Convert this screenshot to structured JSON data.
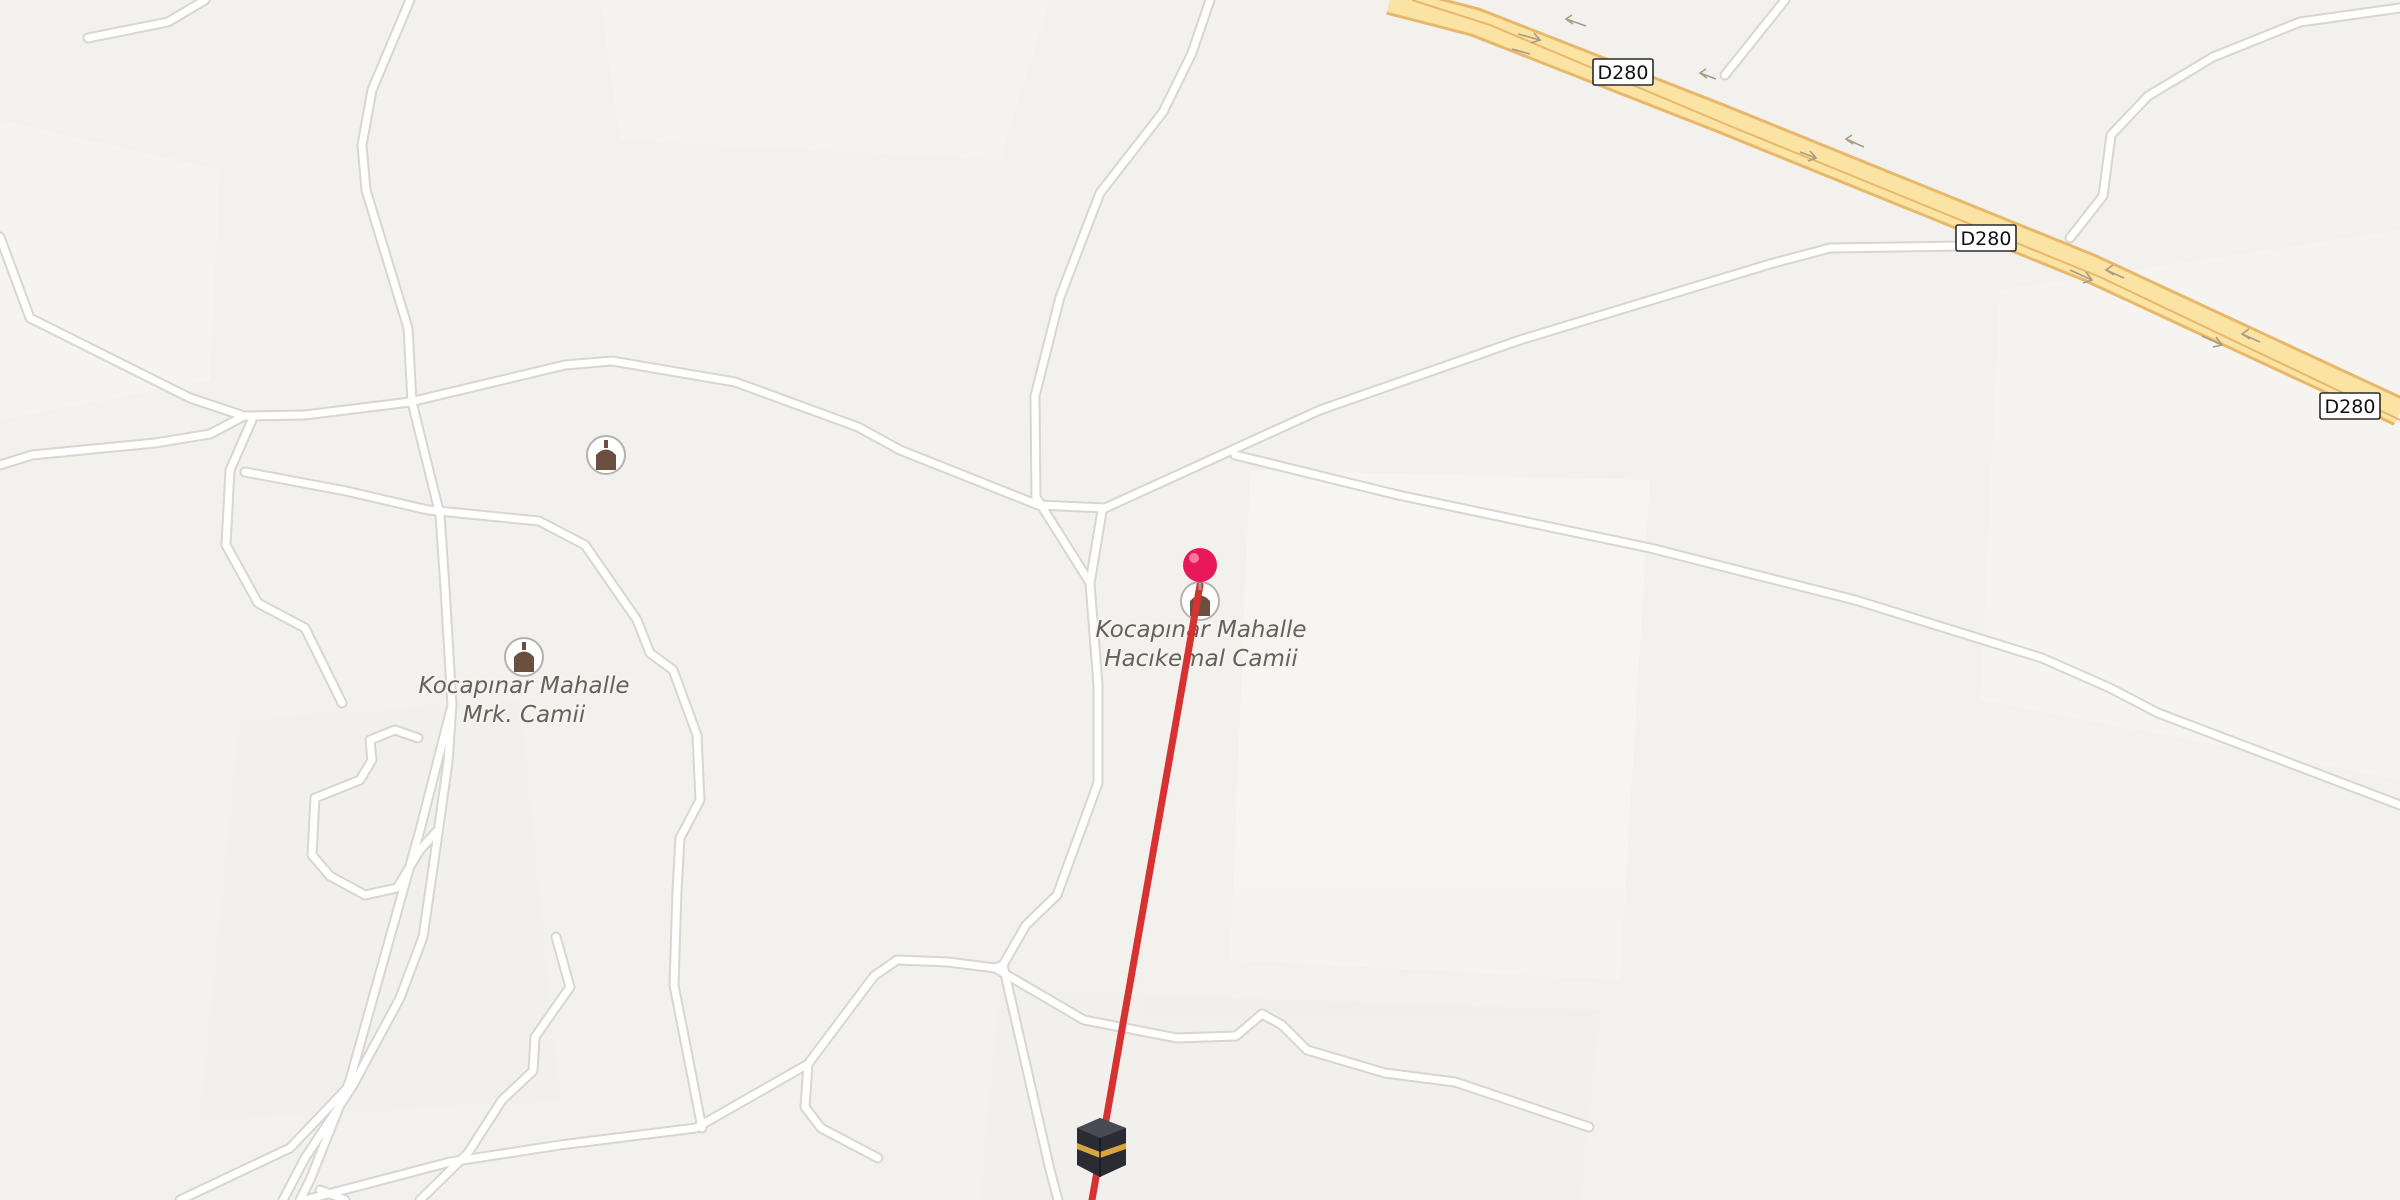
{
  "map": {
    "road_shields": [
      {
        "id": "shield-1",
        "label": "D280"
      },
      {
        "id": "shield-2",
        "label": "D280"
      },
      {
        "id": "shield-3",
        "label": "D280"
      }
    ],
    "pois": [
      {
        "id": "poi-mosque-hacikemal",
        "icon": "mosque-icon",
        "line1": "Kocapınar Mahalle",
        "line2": "Hacıkemal Camii"
      },
      {
        "id": "poi-mosque-mrk",
        "icon": "mosque-icon",
        "line1": "Kocapınar Mahalle",
        "line2": "Mrk. Camii"
      },
      {
        "id": "poi-mosque-unlabeled",
        "icon": "mosque-icon",
        "line1": "",
        "line2": ""
      }
    ],
    "markers": {
      "location_pin": {
        "icon": "location-pin-icon",
        "color": "#e8185a"
      },
      "qibla_destination": {
        "icon": "kaaba-icon"
      }
    },
    "qibla_line_color": "#d63232",
    "colors": {
      "land": "#f3f1ee",
      "minor_road": "#ffffff",
      "highway_fill": "#fbe3a4",
      "highway_casing": "#e8b86a"
    }
  }
}
